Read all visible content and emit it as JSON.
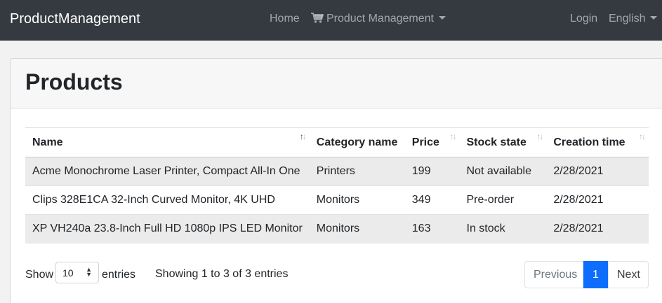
{
  "navbar": {
    "brand": "ProductManagement",
    "home": "Home",
    "product_management": "Product Management",
    "login": "Login",
    "language": "English"
  },
  "page": {
    "title": "Products"
  },
  "table": {
    "columns": [
      "Name",
      "Category name",
      "Price",
      "Stock state",
      "Creation time"
    ],
    "rows": [
      [
        "Acme Monochrome Laser Printer, Compact All-In One",
        "Printers",
        "199",
        "Not available",
        "2/28/2021"
      ],
      [
        "Clips 328E1CA 32-Inch Curved Monitor, 4K UHD",
        "Monitors",
        "349",
        "Pre-order",
        "2/28/2021"
      ],
      [
        "XP VH240a 23.8-Inch Full HD 1080p IPS LED Monitor",
        "Monitors",
        "163",
        "In stock",
        "2/28/2021"
      ]
    ]
  },
  "footer": {
    "show": "Show",
    "page_size": "10",
    "entries": "entries",
    "info": "Showing 1 to 3 of 3 entries",
    "previous": "Previous",
    "current_page": "1",
    "next": "Next"
  },
  "colors": {
    "navbar_bg": "#343a40",
    "active_page": "#0d6efd"
  }
}
